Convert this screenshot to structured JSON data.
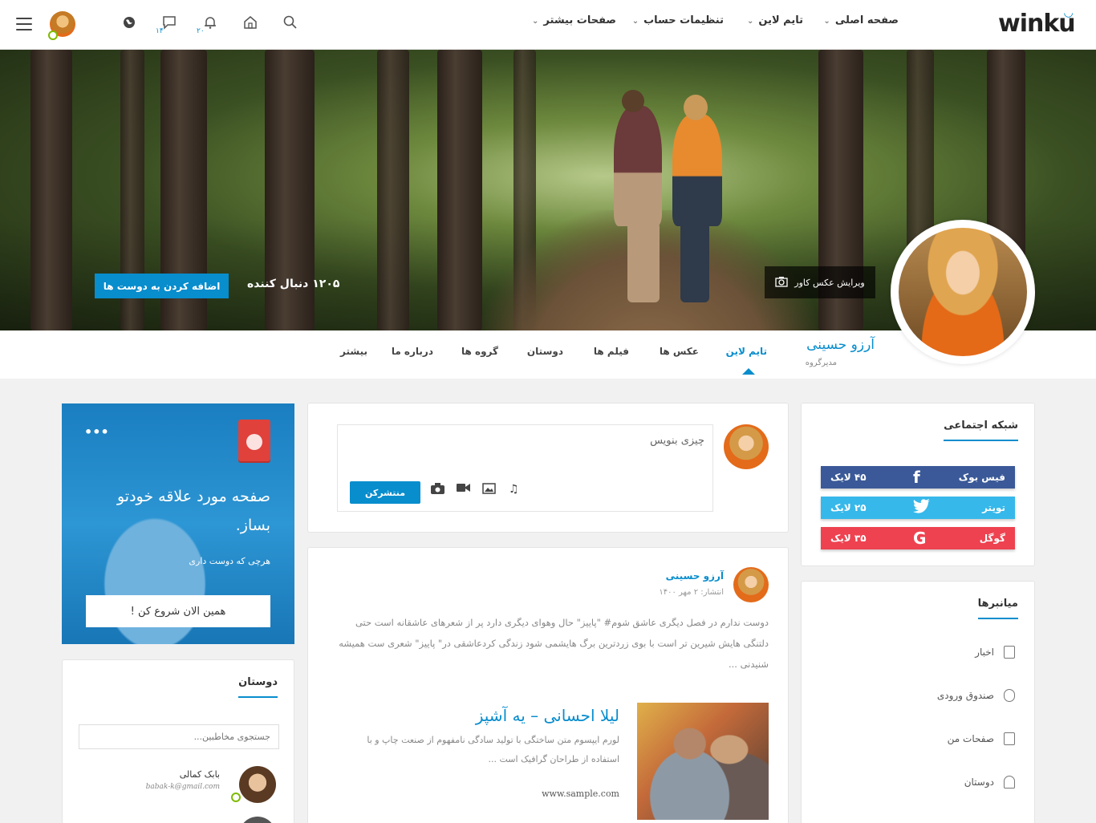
{
  "header": {
    "logo": "winku",
    "nav": [
      {
        "label": "صفحه اصلی"
      },
      {
        "label": "تایم لاین"
      },
      {
        "label": "تنظیمات حساب"
      },
      {
        "label": "صفحات بیشتر"
      }
    ],
    "icons": [
      "search-icon",
      "home-icon",
      "bell-icon",
      "chat-icon",
      "globe-icon"
    ],
    "notifications_count": "۲۰",
    "messages_count": "۱۴"
  },
  "cover": {
    "edit_label": "ویرایش عکس کاور",
    "followers": "۱۲۰۵ دنبال کننده",
    "add_friend": "اضافه کردن به دوست ها"
  },
  "profile": {
    "name": "آرزو حسینی",
    "role": "مدیرگروه",
    "tabs": [
      {
        "label": "تایم لاین",
        "active": true
      },
      {
        "label": "عکس ها"
      },
      {
        "label": "فیلم ها"
      },
      {
        "label": "دوستان"
      },
      {
        "label": "گروه ها"
      },
      {
        "label": "درباره ما"
      },
      {
        "label": "بیشتر"
      }
    ]
  },
  "social": {
    "title": "شبکه اجتماعی",
    "items": [
      {
        "name": "فیس بوک",
        "likes": "۴۵ لایک",
        "color": "#3b5998",
        "icon": "facebook-icon"
      },
      {
        "name": "تویتر",
        "likes": "۲۵ لایک",
        "color": "#36b8ea",
        "icon": "twitter-icon"
      },
      {
        "name": "گوگل",
        "likes": "۳۵ لایک",
        "color": "#ee4250",
        "icon": "google-icon"
      }
    ]
  },
  "shortcuts": {
    "title": "میانبرها",
    "items": [
      {
        "label": "اخبار",
        "icon": "clipboard-icon"
      },
      {
        "label": "صندوق ورودی",
        "icon": "mouse-icon"
      },
      {
        "label": "صفحات من",
        "icon": "pages-icon"
      },
      {
        "label": "دوستان",
        "icon": "user-icon"
      }
    ]
  },
  "composer": {
    "placeholder": "چیزی بنویس",
    "publish": "منتشرکن",
    "tools": [
      "music-icon",
      "image-icon",
      "video-icon",
      "camera-icon"
    ]
  },
  "post": {
    "author": "آرزو حسینی",
    "date": "انتشار: ۲ مهر ۱۴۰۰",
    "body": "دوست ندارم در فصل دیگری عاشق شوم# \"پاییز\" حال وهوای دیگری دارد پر از شعرهای عاشقانه است حتی دلتنگی هایش شیرین تر است با بوی زردترین برگ هایشمی شود زندگی کردعاشقی در\" پاییز\" شعری ست همیشه شنیدنی ...",
    "link_title": "لیلا احسانی – یه آشپز",
    "link_desc": "لورم ایپسوم متن ساختگی با تولید سادگی نامفهوم از صنعت چاپ و با استفاده از طراحان گرافیک است ...",
    "link_url": "www.sample.com"
  },
  "promo": {
    "title": "صفحه مورد علاقه خودتو بساز.",
    "subtitle": "هرچی که دوست داری",
    "button": "همین الان شروع کن !",
    "dots": "•••"
  },
  "friends": {
    "title": "دوستان",
    "search_placeholder": "جستجوی مخاطبین...",
    "list": [
      {
        "name": "بابک کمالی",
        "email": "babak-k@gmail.com",
        "online": true
      }
    ]
  },
  "colors": {
    "accent": "#088dcd",
    "online": "#7fba00"
  }
}
